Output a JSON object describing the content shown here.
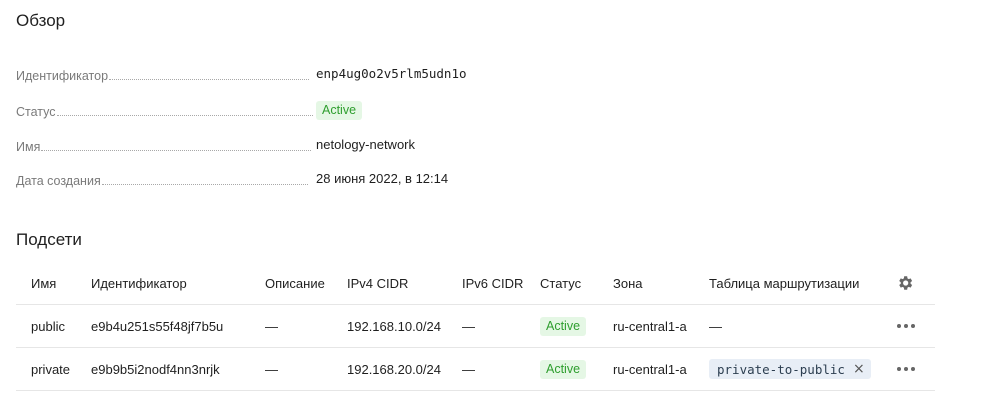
{
  "overview": {
    "title": "Обзор",
    "fields": [
      {
        "label": "Идентификатор",
        "value": "enp4ug0o2v5rlm5udn1o"
      },
      {
        "label": "Статус",
        "value": "Active"
      },
      {
        "label": "Имя",
        "value": "netology-network"
      },
      {
        "label": "Дата создания",
        "value": "28 июня 2022, в 12:14"
      }
    ]
  },
  "subnets": {
    "title": "Подсети",
    "columns": [
      "Имя",
      "Идентификатор",
      "Описание",
      "IPv4 CIDR",
      "IPv6 CIDR",
      "Статус",
      "Зона",
      "Таблица маршрутизации"
    ],
    "rows": [
      {
        "name": "public",
        "id": "e9b4u251s55f48jf7b5u",
        "description": "—",
        "ipv4": "192.168.10.0/24",
        "ipv6": "—",
        "status": "Active",
        "zone": "ru-central1-a",
        "route_table": "—"
      },
      {
        "name": "private",
        "id": "e9b9b5i2nodf4nn3nrjk",
        "description": "—",
        "ipv4": "192.168.20.0/24",
        "ipv6": "—",
        "status": "Active",
        "zone": "ru-central1-a",
        "route_table": "private-to-public",
        "route_table_close": "×"
      }
    ]
  },
  "icons": {
    "settings": "gear-icon",
    "row_menu": "more-horizontal-icon",
    "remove": "close-icon"
  },
  "colors": {
    "active_bg": "#e5f7e5",
    "active_text": "#2e9e2e",
    "chip_bg": "#e8eef6"
  }
}
